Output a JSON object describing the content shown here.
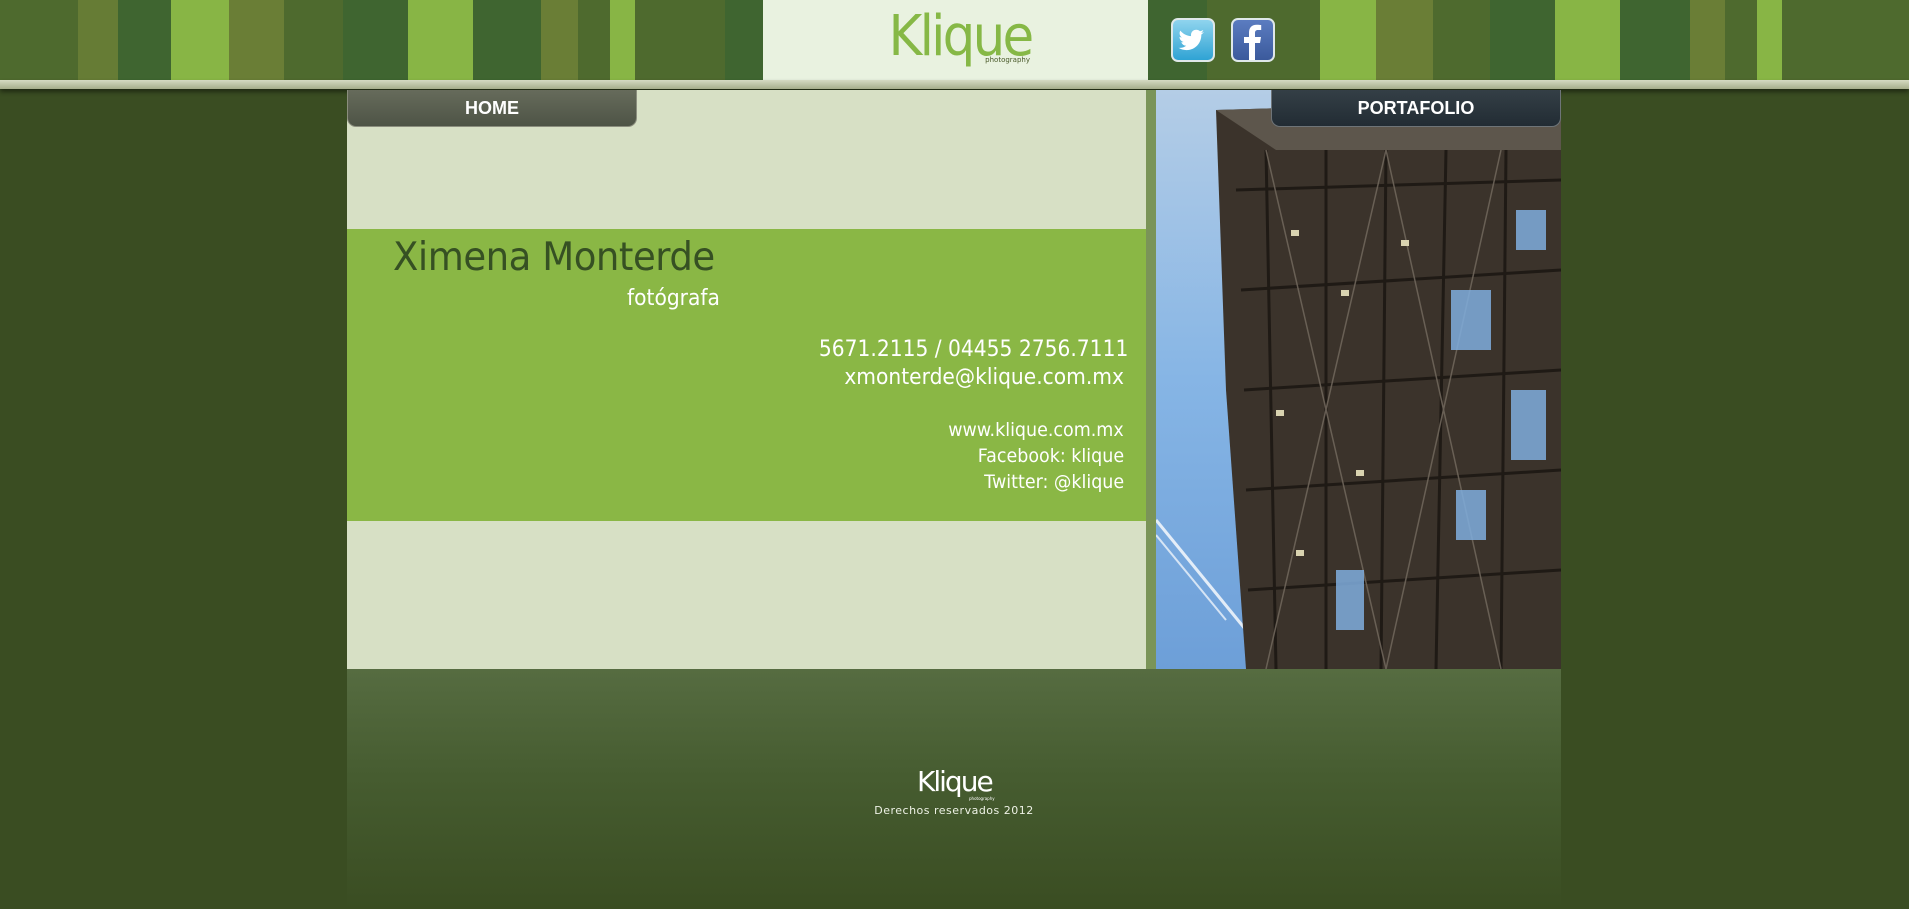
{
  "header": {
    "logo_text": "Klique",
    "logo_sub": "photography",
    "social": [
      {
        "name": "twitter",
        "icon": "twitter-bird-icon"
      },
      {
        "name": "facebook",
        "icon": "facebook-f-icon"
      }
    ]
  },
  "nav": {
    "home_label": "HOME",
    "portfolio_label": "PORTAFOLIO"
  },
  "card": {
    "name": "Ximena Monterde",
    "role": "fotógrafa",
    "phone": "5671.2115 / 04455 2756.7111",
    "email": "xmonterde@klique.com.mx",
    "website": "www.klique.com.mx",
    "facebook": "Facebook: klique",
    "twitter": "Twitter: @klique"
  },
  "footer": {
    "logo_text": "Klique",
    "logo_sub": "photography",
    "copyright": "Derechos reservados 2012"
  },
  "colors": {
    "page_bg": "#3a4d22",
    "card_green": "#8ab745",
    "content_bg": "#d7e0c5",
    "logo_green": "#86b846",
    "name_dark_green": "#365023"
  }
}
